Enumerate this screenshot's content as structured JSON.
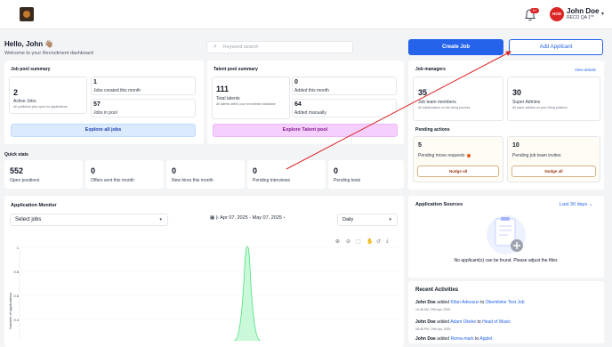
{
  "header": {
    "notif_badge": "9+",
    "avatar_initials": "HOD",
    "user_name": "John Doe",
    "user_org": "RECO QA 1**"
  },
  "greeting": {
    "title": "Hello, John 👋🏽",
    "subtitle": "Welcome to your Recruitment dashboard"
  },
  "search": {
    "placeholder": "Keyword search"
  },
  "actions": {
    "create_job": "Create Job",
    "add_applicant": "Add Applicant"
  },
  "job_pool": {
    "title": "Job pool summary",
    "active_count": "2",
    "active_label": "Active Jobs",
    "active_desc": "All published jobs open for applications",
    "created_count": "1",
    "created_label": "Jobs created this month",
    "pool_count": "57",
    "pool_label": "Jobs in pool",
    "explore_button": "Explore all jobs"
  },
  "talent_pool": {
    "title": "Talent pool summary",
    "total_count": "111",
    "total_label": "Total talents",
    "total_desc": "All talents within your recruitment database",
    "added_month_count": "0",
    "added_month_label": "Added this month",
    "added_manual_count": "64",
    "added_manual_label": "Added manually",
    "explore_button": "Explore Talent pool"
  },
  "job_managers": {
    "title": "Job managers",
    "view_details": "View details",
    "team_count": "35",
    "team_label": "Job team members",
    "team_desc": "All collaborators on the hiring process",
    "admins_count": "30",
    "admins_label": "Super Admins",
    "admins_desc": "All super admins on your hiring platform"
  },
  "pending_actions": {
    "title": "Pending actions",
    "move_count": "5",
    "move_label": "Pending move requests",
    "move_button": "Nudge all",
    "invite_count": "10",
    "invite_label": "Pending job team invites",
    "invite_button": "Nudge all"
  },
  "quick_stats": {
    "title": "Quick stats",
    "items": [
      {
        "value": "552",
        "label": "Open positions"
      },
      {
        "value": "0",
        "label": "Offers sent this month"
      },
      {
        "value": "0",
        "label": "New hires this month"
      },
      {
        "value": "0",
        "label": "Pending interviews"
      },
      {
        "value": "0",
        "label": "Pending tests"
      }
    ]
  },
  "application_monitor": {
    "title": "Application Monitor",
    "select_jobs": "Select jobs",
    "date_range": "Apr 07, 2025 - May 07, 2025",
    "frequency": "Daily",
    "y_axis_label": "Number of applications",
    "y_ticks": [
      "1",
      "0.8",
      "0.6",
      "0.4"
    ]
  },
  "chart_data": {
    "type": "area",
    "ylabel": "Number of applications",
    "yticks": [
      1,
      0.8,
      0.6,
      0.4
    ],
    "ylim": [
      0.3,
      1
    ],
    "series": [
      {
        "peak_value": 1
      }
    ],
    "series_color": "#86efac"
  },
  "application_sources": {
    "title": "Application Sources",
    "range": "Last 30 days",
    "empty_text": "No applicant(s) can be found. Please adjust the filter."
  },
  "recent_activities": {
    "title": "Recent Activities",
    "items": [
      {
        "actor": "John Doe",
        "verb": "added",
        "subject": "Kifan Adeosun",
        "prep": "to",
        "target": "Obemileke Test Job",
        "time": "10:48 AM, 29th Apr, 2025"
      },
      {
        "actor": "John Doe",
        "verb": "added",
        "subject": "Adam Okeke",
        "prep": "to",
        "target": "Head of Music",
        "time": "08:48 PM, 19th Apr, 2025"
      },
      {
        "actor": "John Doe",
        "verb": "added",
        "subject": "Rema-mark",
        "prep": "to",
        "target": "Applet",
        "time": ""
      }
    ]
  },
  "colors": {
    "primary": "#2563eb",
    "danger": "#dc2626",
    "pink": "#f5d0fe",
    "arrow": "#dc2626"
  }
}
